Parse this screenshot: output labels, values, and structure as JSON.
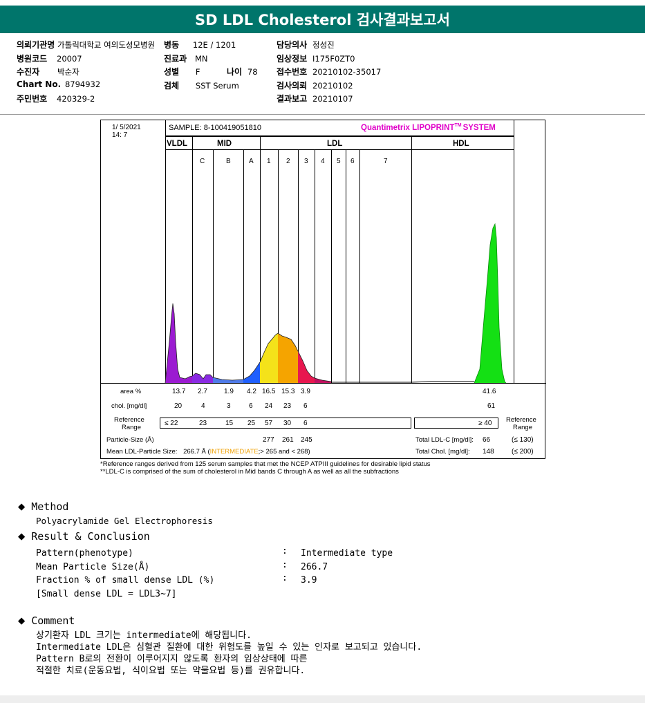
{
  "title": "SD LDL Cholesterol 검사결과보고서",
  "header": {
    "hospital_label": "의뢰기관명",
    "hospital_value": "가톨릭대학교 여의도성모병원",
    "ward_label": "병동",
    "ward_value": "12E / 1201",
    "doctor_label": "담당의사",
    "doctor_value": "정성진",
    "code_label": "병원코드",
    "code_value": "20007",
    "dept_label": "진료과",
    "dept_value": "MN",
    "clinical_label": "임상정보",
    "clinical_value": "I175F0ZT0",
    "patient_label": "수진자",
    "patient_value": "박순자",
    "sex_label": "성별",
    "sex_value": "F",
    "age_label": "나이",
    "age_value": "78",
    "receipt_label": "접수번호",
    "receipt_value": "20210102-35017",
    "chart_label": "Chart No.",
    "chart_value": "8794932",
    "specimen_label": "검체",
    "specimen_value": "SST Serum",
    "request_label": "검사의뢰",
    "request_value": "20210102",
    "resident_label": "주민번호",
    "resident_value": "420329-2",
    "report_label": "결과보고",
    "report_value": "20210107"
  },
  "report": {
    "date": "1/  5/2021",
    "time": "14:  7",
    "sample": "SAMPLE:    8-100419051810",
    "brand": "Quantimetrix LIPOPRINT",
    "brand_tm": "TM",
    "brand_sys": "SYSTEM",
    "groups": {
      "vldl": "VLDL",
      "mid": "MID",
      "ldl": "LDL",
      "hdl": "HDL"
    },
    "subbands": [
      "C",
      "B",
      "A",
      "1",
      "2",
      "3",
      "4",
      "5",
      "6",
      "7"
    ],
    "area_label": "area %",
    "chol_label": "chol. [mg/dl]",
    "ref_label_1": "Reference",
    "ref_label_2": "Range",
    "area_values": [
      "13.7",
      "2.7",
      "1.9",
      "4.2",
      "16.5",
      "15.3",
      "3.9"
    ],
    "area_hdl": "41.6",
    "chol_values": [
      "20",
      "4",
      "3",
      "6",
      "24",
      "23",
      "6"
    ],
    "chol_hdl": "61",
    "ref_first": "≤  22",
    "ref_values": [
      "23",
      "15",
      "25",
      "57",
      "30",
      "6"
    ],
    "ref_hdl": "≥ 40",
    "particle_label": "Particle-Size (Å)",
    "particle_values": [
      "277",
      "261",
      "245"
    ],
    "mean_label": "Mean LDL-Particle Size:",
    "mean_value": "266.7 Å (",
    "mean_type": "INTERMEDIATE",
    "mean_tail": ";> 265 and < 268)",
    "total_ldl_label": "Total LDL-C [mg/dl]:",
    "total_ldl_value": "66",
    "total_ldl_ref": "(≤ 130)",
    "total_chol_label": "Total Chol. [mg/dl]:",
    "total_chol_value": "148",
    "total_chol_ref": "(≤ 200)"
  },
  "chart_data": {
    "type": "area",
    "bands": [
      "VLDL",
      "MID C",
      "MID B",
      "MID A",
      "LDL 1",
      "LDL 2",
      "LDL 3",
      "LDL 4",
      "LDL 5",
      "LDL 6",
      "LDL 7",
      "HDL"
    ],
    "area_percent": [
      13.7,
      2.7,
      1.9,
      4.2,
      16.5,
      15.3,
      3.9,
      null,
      null,
      null,
      null,
      41.6
    ],
    "chol_mg_dl": [
      20,
      4,
      3,
      6,
      24,
      23,
      6,
      null,
      null,
      null,
      null,
      61
    ],
    "colors": {
      "vldl": "#9b1bd1",
      "mid": "#8a2be2",
      "midA": "#1f5fff",
      "ldl1": "#f4e21a",
      "ldl2": "#f5a400",
      "ldl3": "#e8174f",
      "hdl": "#14e014"
    }
  },
  "footnotes": [
    "*Reference ranges derived from 125 serum samples that met the NCEP ATPIII guidelines for desirable lipid status",
    "**LDL-C is comprised of the sum of cholesterol in Mid bands C through A as well as all the subfractions"
  ],
  "method": {
    "title": "Method",
    "text": "Polyacrylamide Gel Electrophoresis"
  },
  "result": {
    "title": "Result & Conclusion",
    "rows": [
      {
        "label": "Pattern(phenotype)",
        "value": "Intermediate type"
      },
      {
        "label": "Mean Particle Size(Å)",
        "value": "266.7"
      },
      {
        "label": "Fraction % of small dense LDL (%)",
        "value": "3.9"
      }
    ],
    "note": "[Small dense LDL = LDL3~7]",
    "colon": ":"
  },
  "comment": {
    "title": "Comment",
    "lines": [
      "상기환자 LDL 크기는 intermediate에 해당됩니다.",
      "Intermediate LDL은 심혈관 질환에 대한 위험도를 높일 수 있는 인자로 보고되고 있습니다.",
      "Pattern B로의 전환이 이루어지지 않도록 환자의 임상상태에 따른",
      "적절한 치료(운동요법, 식이요법 또는 약물요법 등)를 권유합니다."
    ]
  },
  "diamond": "◆"
}
